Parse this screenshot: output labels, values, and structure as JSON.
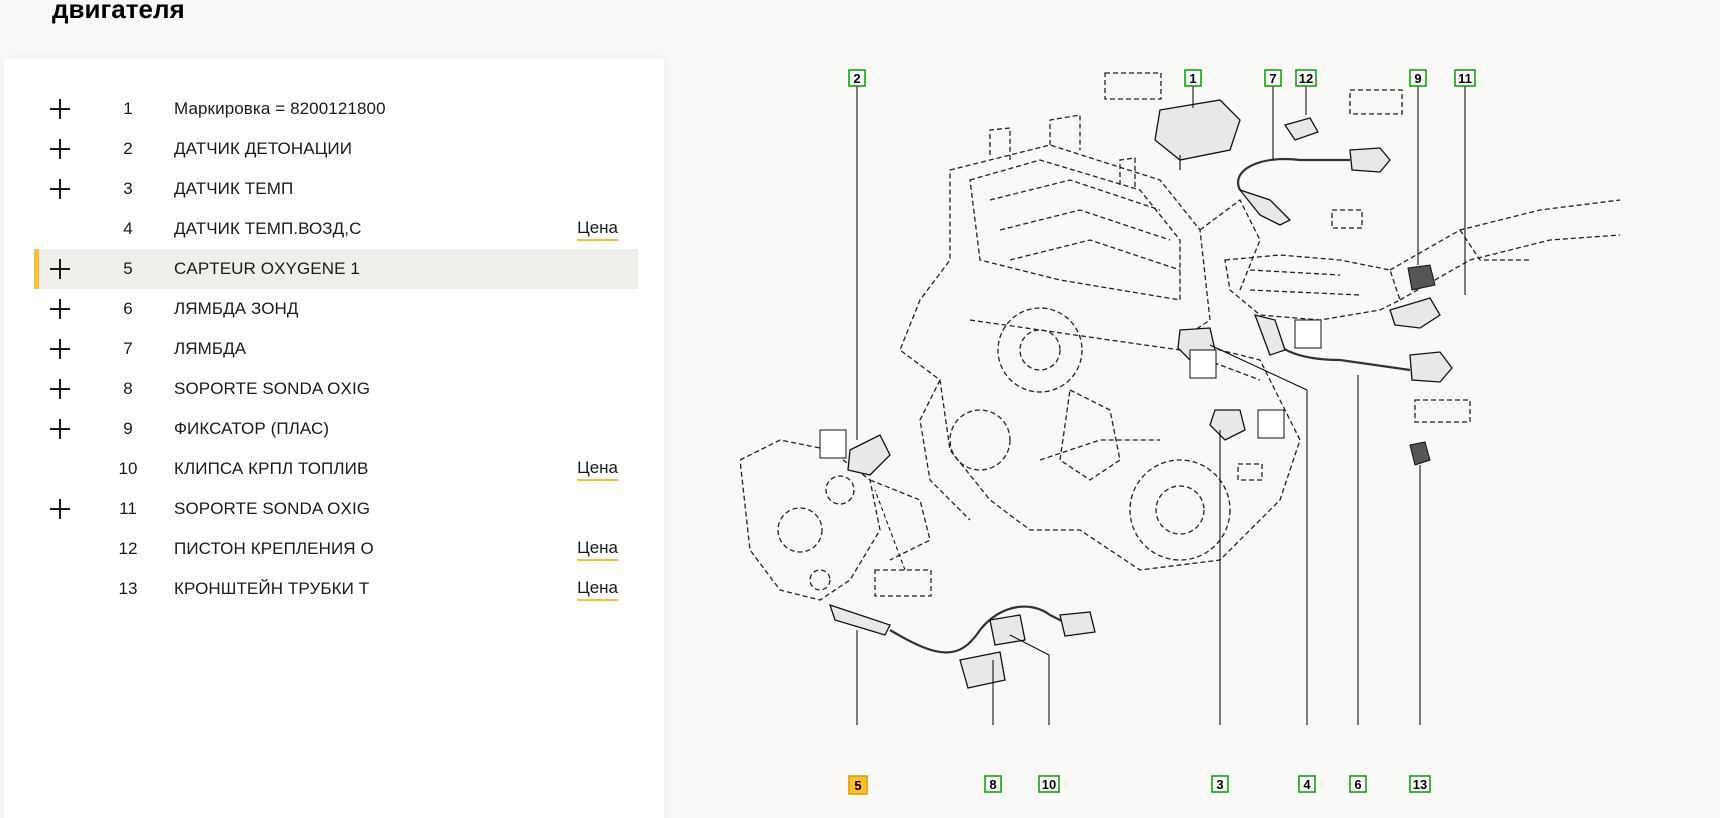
{
  "page": {
    "title": "двигателя"
  },
  "parts": [
    {
      "num": "1",
      "name": "Маркировка = 8200121800",
      "expandable": true,
      "price": ""
    },
    {
      "num": "2",
      "name": "ДАТЧИК ДЕТОНАЦИИ",
      "expandable": true,
      "price": ""
    },
    {
      "num": "3",
      "name": "ДАТЧИК ТЕМП",
      "expandable": true,
      "price": ""
    },
    {
      "num": "4",
      "name": "ДАТЧИК ТЕМП.ВОЗД,С",
      "expandable": false,
      "price": "Цена"
    },
    {
      "num": "5",
      "name": "CAPTEUR OXYGENE 1",
      "expandable": true,
      "price": "",
      "selected": true
    },
    {
      "num": "6",
      "name": "ЛЯМБДА ЗОНД",
      "expandable": true,
      "price": ""
    },
    {
      "num": "7",
      "name": "ЛЯМБДА",
      "expandable": true,
      "price": ""
    },
    {
      "num": "8",
      "name": "SOPORTE SONDA OXIG",
      "expandable": true,
      "price": ""
    },
    {
      "num": "9",
      "name": "ФИКСАТОР (ПЛАС)",
      "expandable": true,
      "price": ""
    },
    {
      "num": "10",
      "name": "КЛИПСА КРПЛ ТОПЛИВ",
      "expandable": false,
      "price": "Цена"
    },
    {
      "num": "11",
      "name": "SOPORTE SONDA OXIG",
      "expandable": true,
      "price": ""
    },
    {
      "num": "12",
      "name": "ПИСТОН КРЕПЛЕНИЯ О",
      "expandable": false,
      "price": "Цена"
    },
    {
      "num": "13",
      "name": "КРОНШТЕЙН ТРУБКИ Т",
      "expandable": false,
      "price": "Цена"
    }
  ],
  "diagram": {
    "callouts": [
      "2",
      "1",
      "7",
      "12",
      "9",
      "11",
      "5",
      "8",
      "10",
      "3",
      "4",
      "6",
      "13"
    ],
    "active_callout": "5"
  },
  "colors": {
    "accent": "#ffbe33",
    "callout_border": "#00a000",
    "selected_row": "#efeeeb"
  }
}
